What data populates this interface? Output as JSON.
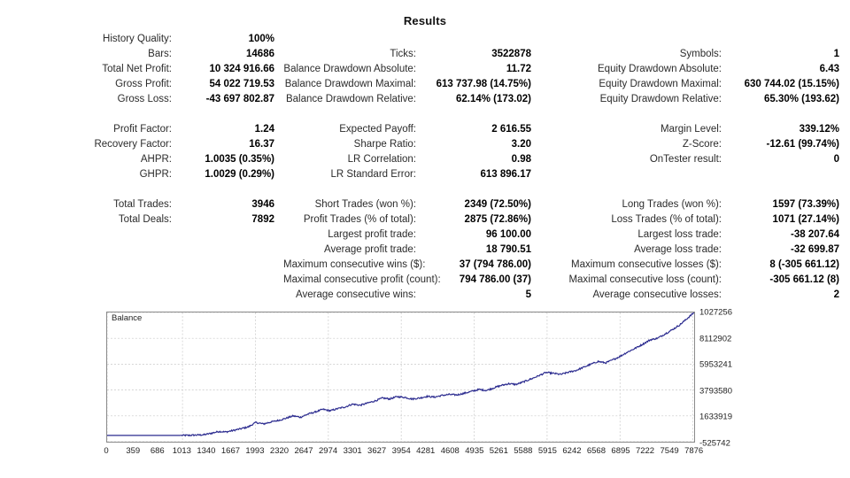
{
  "title": "Results",
  "columns": {
    "left": [
      {
        "label": "History Quality:",
        "value": "100%"
      },
      {
        "label": "Bars:",
        "value": "14686"
      },
      {
        "label": "Total Net Profit:",
        "value": "10 324 916.66"
      },
      {
        "label": "Gross Profit:",
        "value": "54 022 719.53"
      },
      {
        "label": "Gross Loss:",
        "value": "-43 697 802.87"
      },
      {
        "spacer": true
      },
      {
        "label": "Profit Factor:",
        "value": "1.24"
      },
      {
        "label": "Recovery Factor:",
        "value": "16.37"
      },
      {
        "label": "AHPR:",
        "value": "1.0035 (0.35%)"
      },
      {
        "label": "GHPR:",
        "value": "1.0029 (0.29%)"
      },
      {
        "spacer": true
      },
      {
        "label": "Total Trades:",
        "value": "3946"
      },
      {
        "label": "Total Deals:",
        "value": "7892"
      }
    ],
    "middle": [
      {
        "spacer": true
      },
      {
        "label": "Ticks:",
        "value": "3522878"
      },
      {
        "label": "Balance Drawdown Absolute:",
        "value": "11.72"
      },
      {
        "label": "Balance Drawdown Maximal:",
        "value": "613 737.98 (14.75%)"
      },
      {
        "label": "Balance Drawdown Relative:",
        "value": "62.14% (173.02)"
      },
      {
        "spacer": true
      },
      {
        "label": "Expected Payoff:",
        "value": "2 616.55"
      },
      {
        "label": "Sharpe Ratio:",
        "value": "3.20"
      },
      {
        "label": "LR Correlation:",
        "value": "0.98"
      },
      {
        "label": "LR Standard Error:",
        "value": "613 896.17"
      },
      {
        "spacer": true
      },
      {
        "label": "Short Trades (won %):",
        "value": "2349 (72.50%)"
      },
      {
        "label": "Profit Trades (% of total):",
        "value": "2875 (72.86%)"
      },
      {
        "label": "Largest profit trade:",
        "value": "96 100.00"
      },
      {
        "label": "Average profit trade:",
        "value": "18 790.51"
      },
      {
        "label": "Maximum consecutive wins ($):",
        "value": "37 (794 786.00)"
      },
      {
        "label": "Maximal consecutive profit (count):",
        "value": "794 786.00 (37)"
      },
      {
        "label": "Average consecutive wins:",
        "value": "5"
      }
    ],
    "right": [
      {
        "spacer": true
      },
      {
        "label": "Symbols:",
        "value": "1"
      },
      {
        "label": "Equity Drawdown Absolute:",
        "value": "6.43"
      },
      {
        "label": "Equity Drawdown Maximal:",
        "value": "630 744.02 (15.15%)"
      },
      {
        "label": "Equity Drawdown Relative:",
        "value": "65.30% (193.62)"
      },
      {
        "spacer": true
      },
      {
        "label": "Margin Level:",
        "value": "339.12%"
      },
      {
        "label": "Z-Score:",
        "value": "-12.61 (99.74%)"
      },
      {
        "label": "OnTester result:",
        "value": "0"
      },
      {
        "spacer": true
      },
      {
        "spacer": true
      },
      {
        "label": "Long Trades (won %):",
        "value": "1597 (73.39%)"
      },
      {
        "label": "Loss Trades (% of total):",
        "value": "1071 (27.14%)"
      },
      {
        "label": "Largest loss trade:",
        "value": "-38 207.64"
      },
      {
        "label": "Average loss trade:",
        "value": "-32 699.87"
      },
      {
        "label": "Maximum consecutive losses ($):",
        "value": "8 (-305 661.12)"
      },
      {
        "label": "Maximal consecutive loss (count):",
        "value": "-305 661.12 (8)"
      },
      {
        "label": "Average consecutive losses:",
        "value": "2"
      }
    ]
  },
  "chart_data": {
    "type": "line",
    "title": "",
    "legend": "Balance",
    "legend_position": "top-left",
    "grid": true,
    "line_color": "#2b2b8f",
    "xlabel": "",
    "ylabel": "",
    "xlim": [
      0,
      7892
    ],
    "ylim": [
      -525742,
      10272563
    ],
    "ytick_labels": [
      "1027256",
      "8112902",
      "5953241",
      "3793580",
      "1633919",
      "-525742"
    ],
    "ytick_values": [
      10272563,
      8112902,
      5953241,
      3793580,
      1633919,
      -525742
    ],
    "xtick_labels": [
      "0",
      "359",
      "686",
      "1013",
      "1340",
      "1667",
      "1993",
      "2320",
      "2647",
      "2974",
      "3301",
      "3627",
      "3954",
      "4281",
      "4608",
      "4935",
      "5261",
      "5588",
      "5915",
      "6242",
      "6568",
      "6895",
      "7222",
      "7549",
      "7876"
    ],
    "xtick_values": [
      0,
      359,
      686,
      1013,
      1340,
      1667,
      1993,
      2320,
      2647,
      2974,
      3301,
      3627,
      3954,
      4281,
      4608,
      4935,
      5261,
      5588,
      5915,
      6242,
      6568,
      6895,
      7222,
      7549,
      7876
    ],
    "series": [
      {
        "name": "Balance",
        "x": [
          0,
          200,
          400,
          600,
          800,
          1000,
          1100,
          1200,
          1300,
          1400,
          1500,
          1600,
          1700,
          1800,
          1900,
          2000,
          2100,
          2200,
          2300,
          2400,
          2500,
          2600,
          2700,
          2800,
          2900,
          3000,
          3100,
          3200,
          3300,
          3400,
          3500,
          3600,
          3700,
          3800,
          3900,
          4000,
          4100,
          4200,
          4300,
          4400,
          4500,
          4600,
          4700,
          4800,
          4900,
          5000,
          5100,
          5200,
          5300,
          5400,
          5500,
          5600,
          5700,
          5800,
          5900,
          6000,
          6100,
          6200,
          6300,
          6400,
          6500,
          6600,
          6700,
          6800,
          6900,
          7000,
          7100,
          7200,
          7300,
          7400,
          7500,
          7600,
          7700,
          7800,
          7892
        ],
        "y": [
          0,
          0,
          0,
          0,
          0,
          0,
          8000,
          30000,
          55000,
          180000,
          330000,
          290000,
          420000,
          560000,
          720000,
          1080000,
          960000,
          1120000,
          1250000,
          1420000,
          1630000,
          1520000,
          1780000,
          1960000,
          2180000,
          2060000,
          2240000,
          2380000,
          2620000,
          2520000,
          2700000,
          2880000,
          3120000,
          3050000,
          3240000,
          3180000,
          3040000,
          3120000,
          3260000,
          3200000,
          3340000,
          3420000,
          3380000,
          3520000,
          3680000,
          3840000,
          3760000,
          3980000,
          4180000,
          4320000,
          4260000,
          4480000,
          4720000,
          4980000,
          5260000,
          5180000,
          5100000,
          5280000,
          5420000,
          5680000,
          5940000,
          6180000,
          6060000,
          6320000,
          6620000,
          6980000,
          7280000,
          7620000,
          7980000,
          8120000,
          8480000,
          8840000,
          9240000,
          9780000,
          10272563
        ]
      }
    ]
  }
}
